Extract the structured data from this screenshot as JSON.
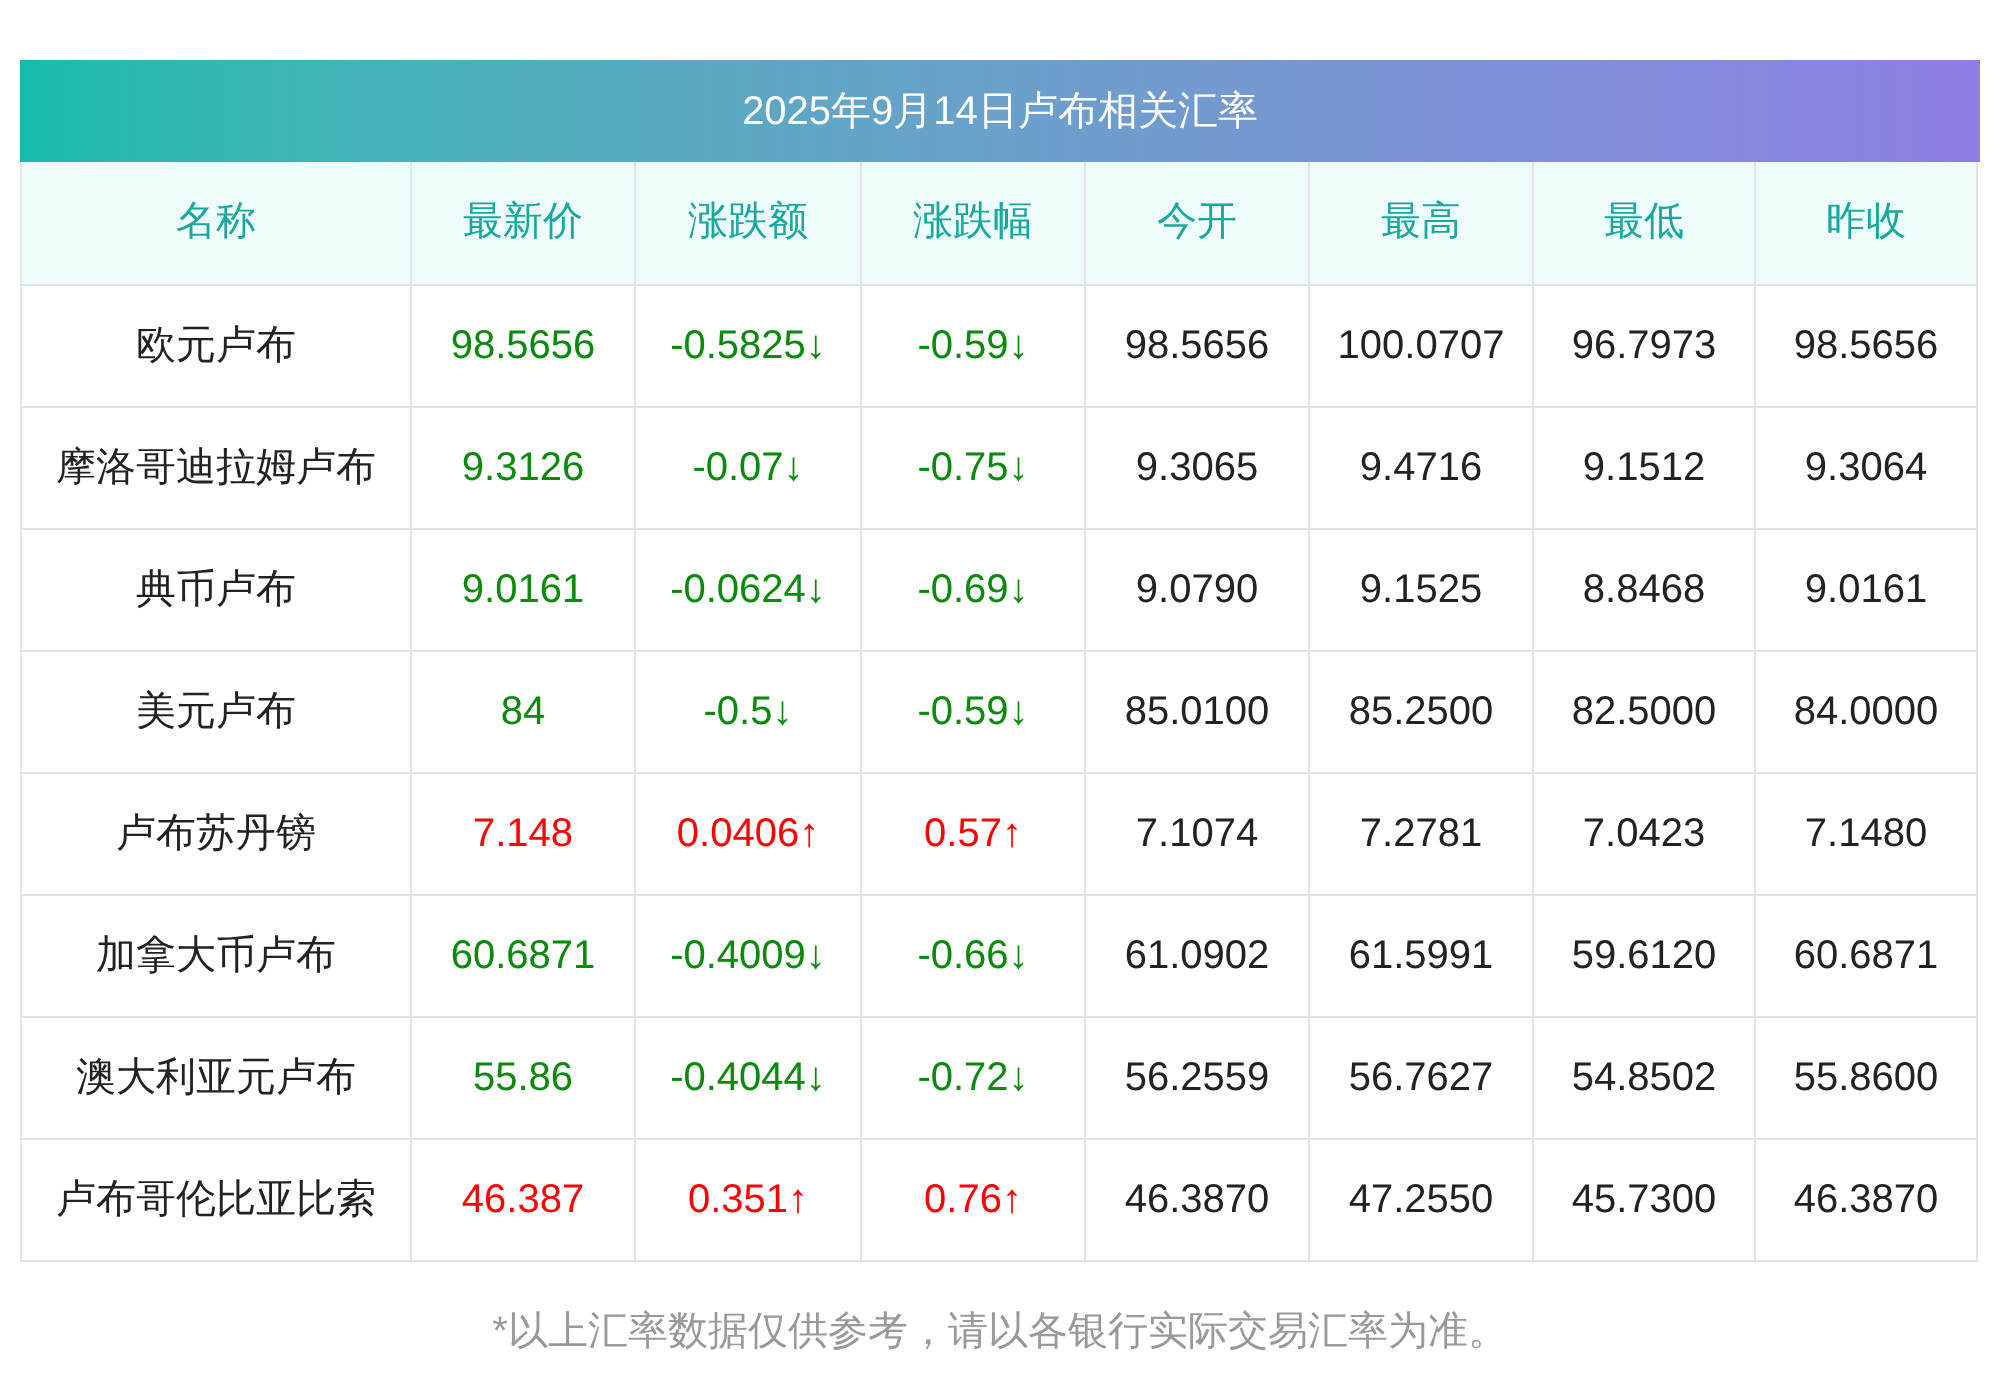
{
  "title": "2025年9月14日卢布相关汇率",
  "columns": [
    "名称",
    "最新价",
    "涨跌额",
    "涨跌幅",
    "今开",
    "最高",
    "最低",
    "昨收"
  ],
  "rows": [
    {
      "rising": false,
      "cells": [
        "欧元卢布",
        "98.5656",
        "-0.5825↓",
        "-0.59↓",
        "98.5656",
        "100.0707",
        "96.7973",
        "98.5656"
      ]
    },
    {
      "rising": false,
      "cells": [
        "摩洛哥迪拉姆卢布",
        "9.3126",
        "-0.07↓",
        "-0.75↓",
        "9.3065",
        "9.4716",
        "9.1512",
        "9.3064"
      ]
    },
    {
      "rising": false,
      "cells": [
        "典币卢布",
        "9.0161",
        "-0.0624↓",
        "-0.69↓",
        "9.0790",
        "9.1525",
        "8.8468",
        "9.0161"
      ]
    },
    {
      "rising": false,
      "cells": [
        "美元卢布",
        "84",
        "-0.5↓",
        "-0.59↓",
        "85.0100",
        "85.2500",
        "82.5000",
        "84.0000"
      ]
    },
    {
      "rising": true,
      "cells": [
        "卢布苏丹镑",
        "7.148",
        "0.0406↑",
        "0.57↑",
        "7.1074",
        "7.2781",
        "7.0423",
        "7.1480"
      ]
    },
    {
      "rising": false,
      "cells": [
        "加拿大币卢布",
        "60.6871",
        "-0.4009↓",
        "-0.66↓",
        "61.0902",
        "61.5991",
        "59.6120",
        "60.6871"
      ]
    },
    {
      "rising": false,
      "cells": [
        "澳大利亚元卢布",
        "55.86",
        "-0.4044↓",
        "-0.72↓",
        "56.2559",
        "56.7627",
        "54.8502",
        "55.8600"
      ]
    },
    {
      "rising": true,
      "cells": [
        "卢布哥伦比亚比索",
        "46.387",
        "0.351↑",
        "0.76↑",
        "46.3870",
        "47.2550",
        "45.7300",
        "46.3870"
      ]
    }
  ],
  "footnote": "*以上汇率数据仅供参考，请以各银行实际交易汇率为准。"
}
